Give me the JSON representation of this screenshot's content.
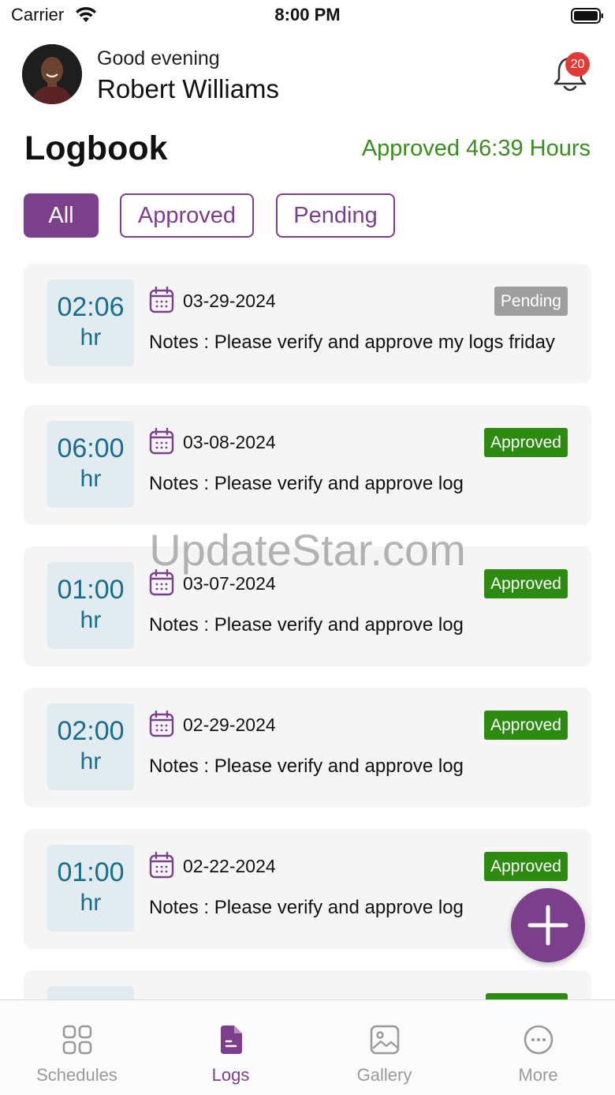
{
  "status_bar": {
    "carrier": "Carrier",
    "time": "8:00 PM"
  },
  "header": {
    "greeting": "Good evening",
    "user_name": "Robert Williams",
    "notification_count": "20"
  },
  "page": {
    "title": "Logbook",
    "approved_hours": "Approved 46:39 Hours"
  },
  "filters": [
    {
      "label": "All",
      "active": true
    },
    {
      "label": "Approved",
      "active": false
    },
    {
      "label": "Pending",
      "active": false
    }
  ],
  "logs": [
    {
      "hours": "02:06",
      "unit": "hr",
      "date": "03-29-2024",
      "notes": "Notes : Please verify and approve my logs friday",
      "status": "Pending"
    },
    {
      "hours": "06:00",
      "unit": "hr",
      "date": "03-08-2024",
      "notes": "Notes : Please verify and approve log",
      "status": "Approved"
    },
    {
      "hours": "01:00",
      "unit": "hr",
      "date": "03-07-2024",
      "notes": "Notes : Please verify and approve log",
      "status": "Approved"
    },
    {
      "hours": "02:00",
      "unit": "hr",
      "date": "02-29-2024",
      "notes": "Notes : Please verify and approve log",
      "status": "Approved"
    },
    {
      "hours": "01:00",
      "unit": "hr",
      "date": "02-22-2024",
      "notes": "Notes : Please verify and approve log",
      "status": "Approved"
    }
  ],
  "watermark": "UpdateStar.com",
  "bottom_nav": [
    {
      "label": "Schedules",
      "icon": "grid-icon",
      "active": false
    },
    {
      "label": "Logs",
      "icon": "document-icon",
      "active": true
    },
    {
      "label": "Gallery",
      "icon": "image-icon",
      "active": false
    },
    {
      "label": "More",
      "icon": "more-icon",
      "active": false
    }
  ],
  "colors": {
    "brand": "#7b3f8c",
    "approved": "#2e8b12",
    "pending": "#9e9e9e",
    "hours_text": "#1a6d8c",
    "hours_bg": "#e1ebf0",
    "approved_hours_text": "#3a8d1e",
    "badge": "#e53935"
  }
}
